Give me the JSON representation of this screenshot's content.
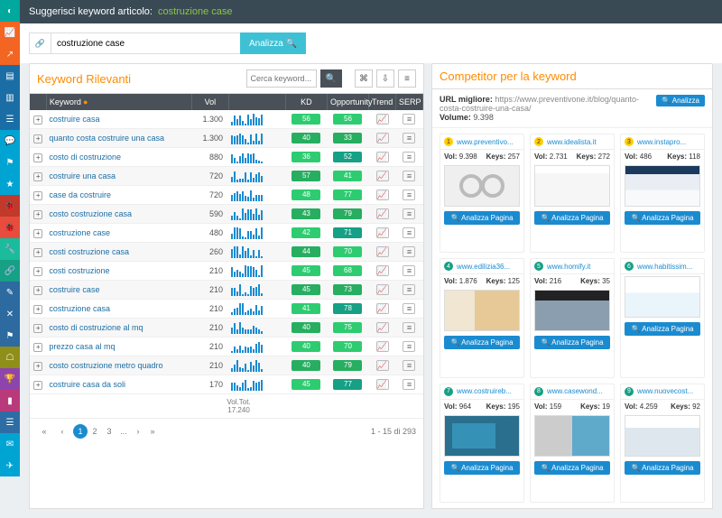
{
  "nav_icons": [
    "◐",
    "📈",
    "↗",
    "▤",
    "▥",
    "☰",
    "💬",
    "⚑",
    "★",
    "🐞",
    "🐞",
    "🔧",
    "🔗",
    "✎",
    "✕",
    "⚑",
    "☖",
    "🏆",
    "▮",
    "☰",
    "✉",
    "✈"
  ],
  "topbar": {
    "label": "Suggerisci keyword articolo:",
    "keyword": "costruzione case"
  },
  "search": {
    "value": "costruzione case",
    "analyze": "Analizza"
  },
  "kw_panel": {
    "title": "Keyword Rilevanti",
    "search_placeholder": "Cerca keyword...",
    "columns": {
      "keyword": "Keyword",
      "vol": "Vol",
      "kd": "KD",
      "opp": "Opportunity",
      "trend": "Trend",
      "serp": "SERP"
    },
    "rows": [
      {
        "kw": "costruire casa",
        "vol": "1.300",
        "kd": "56",
        "opp": "56"
      },
      {
        "kw": "quanto costa costruire una casa",
        "vol": "1.300",
        "kd": "40",
        "opp": "33"
      },
      {
        "kw": "costo di costruzione",
        "vol": "880",
        "kd": "36",
        "opp": "52"
      },
      {
        "kw": "costruire una casa",
        "vol": "720",
        "kd": "57",
        "opp": "41"
      },
      {
        "kw": "case da costruire",
        "vol": "720",
        "kd": "48",
        "opp": "77"
      },
      {
        "kw": "costo costruzione casa",
        "vol": "590",
        "kd": "43",
        "opp": "79"
      },
      {
        "kw": "costruzione case",
        "vol": "480",
        "kd": "42",
        "opp": "71"
      },
      {
        "kw": "costi costruzione casa",
        "vol": "260",
        "kd": "44",
        "opp": "70"
      },
      {
        "kw": "costi costruzione",
        "vol": "210",
        "kd": "45",
        "opp": "68"
      },
      {
        "kw": "costruire case",
        "vol": "210",
        "kd": "45",
        "opp": "73"
      },
      {
        "kw": "costruzione casa",
        "vol": "210",
        "kd": "41",
        "opp": "78"
      },
      {
        "kw": "costo di costruzione al mq",
        "vol": "210",
        "kd": "40",
        "opp": "75"
      },
      {
        "kw": "prezzo casa al mq",
        "vol": "210",
        "kd": "40",
        "opp": "70"
      },
      {
        "kw": "costo costruzione metro quadro",
        "vol": "210",
        "kd": "40",
        "opp": "79"
      },
      {
        "kw": "costruire casa da soli",
        "vol": "170",
        "kd": "45",
        "opp": "77"
      }
    ],
    "total_label": "Vol.Tot.",
    "total_value": "17.240",
    "pager": {
      "pages": [
        "1",
        "2",
        "3",
        "...",
        "›",
        "»"
      ],
      "summary": "1 - 15 di 293"
    }
  },
  "cmp_panel": {
    "title": "Competitor per la keyword",
    "best_label": "URL migliore:",
    "best_url": "https://www.preventivone.it/blog/quanto-costa-costruire-una-casa/",
    "volume_label": "Volume:",
    "volume_value": "9.398",
    "analyze_btn": "Analizza",
    "card_btn": "Analizza Pagina",
    "cards": [
      {
        "rank": 1,
        "domain": "www.preventivo...",
        "vol": "9.398",
        "keys": "257",
        "thumb": "inf"
      },
      {
        "rank": 2,
        "domain": "www.idealista.it",
        "vol": "2.731",
        "keys": "272",
        "thumb": "site1"
      },
      {
        "rank": 3,
        "domain": "www.instapro...",
        "vol": "486",
        "keys": "118",
        "thumb": "site2"
      },
      {
        "rank": 4,
        "domain": "www.edilizia36...",
        "vol": "1.876",
        "keys": "125",
        "thumb": "site3"
      },
      {
        "rank": 5,
        "domain": "www.homify.it",
        "vol": "216",
        "keys": "35",
        "thumb": "site4"
      },
      {
        "rank": 6,
        "domain": "www.habitissim...",
        "vol": "",
        "keys": "",
        "thumb": "site5"
      },
      {
        "rank": 7,
        "domain": "www.costruireb...",
        "vol": "964",
        "keys": "195",
        "thumb": "site6"
      },
      {
        "rank": 8,
        "domain": "www.casewond...",
        "vol": "159",
        "keys": "19",
        "thumb": "site7"
      },
      {
        "rank": 9,
        "domain": "www.nuovecost...",
        "vol": "4.259",
        "keys": "92",
        "thumb": "site8"
      }
    ],
    "vol_label": "Vol:",
    "keys_label": "Keys:"
  }
}
